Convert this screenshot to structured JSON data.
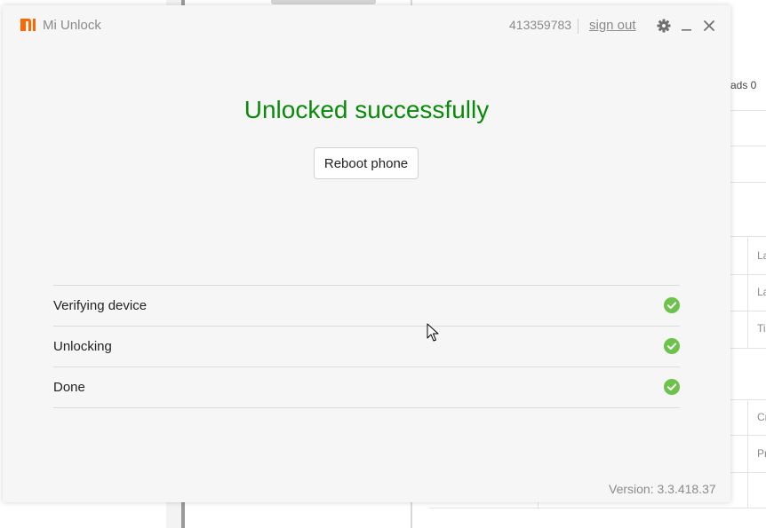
{
  "background_window": {
    "downloads_text": "ads 0",
    "cell_texts": [
      "La",
      "La",
      "Ti",
      "Cr",
      "Pr"
    ]
  },
  "mi_unlock": {
    "title": "Mi Unlock",
    "account_id": "413359783",
    "sign_out": "sign out",
    "status_title": "Unlocked successfully",
    "reboot_button": "Reboot phone",
    "steps": [
      {
        "label": "Verifying device",
        "done": true
      },
      {
        "label": "Unlocking",
        "done": true
      },
      {
        "label": "Done",
        "done": true
      }
    ],
    "version": "Version: 3.3.418.37"
  },
  "colors": {
    "brand_orange": "#ff6700",
    "success_green": "#0a8a0a",
    "check_green": "#6cc24a"
  }
}
